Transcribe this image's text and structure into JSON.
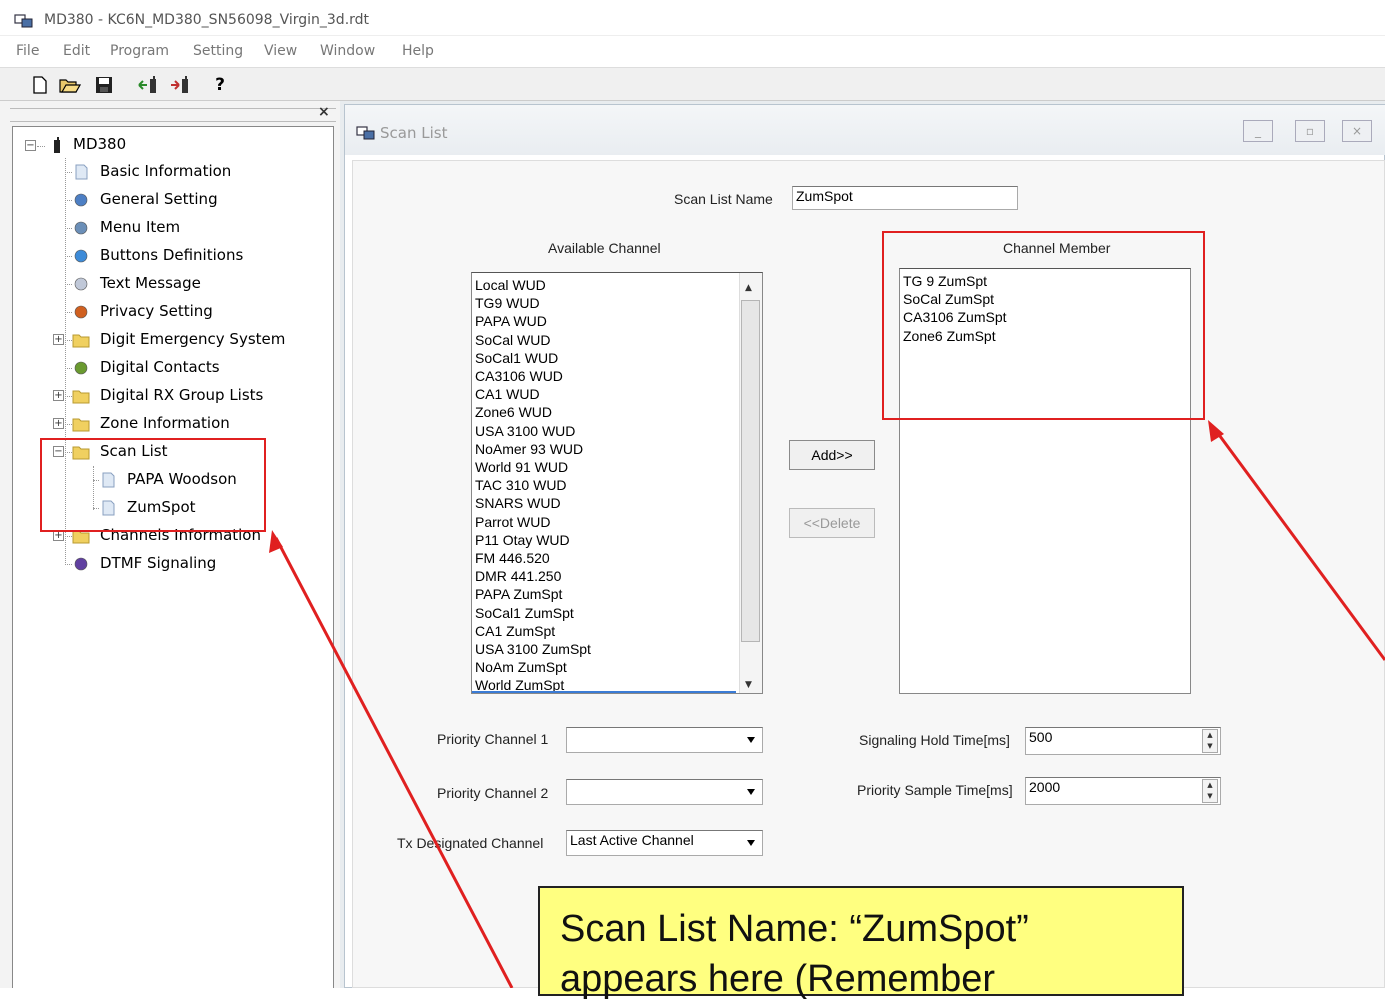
{
  "window": {
    "title": "MD380 - KC6N_MD380_SN56098_Virgin_3d.rdt"
  },
  "menu": [
    "File",
    "Edit",
    "Program",
    "Setting",
    "View",
    "Window",
    "Help"
  ],
  "toolbar": {
    "icons": [
      "new-icon",
      "open-icon",
      "save-icon",
      "read-from-radio-icon",
      "write-to-radio-icon",
      "help-icon"
    ],
    "help_glyph": "?"
  },
  "tree": {
    "close_glyph": "×",
    "root": "MD380",
    "items": [
      {
        "label": "Basic Information",
        "icon": "document-icon"
      },
      {
        "label": "General Setting",
        "icon": "gear-icon"
      },
      {
        "label": "Menu Item",
        "icon": "menu-icon"
      },
      {
        "label": "Buttons Definitions",
        "icon": "globe-icon"
      },
      {
        "label": "Text Message",
        "icon": "message-icon"
      },
      {
        "label": "Privacy Setting",
        "icon": "key-icon"
      },
      {
        "label": "Digit Emergency System",
        "icon": "folder-icon"
      },
      {
        "label": "Digital Contacts",
        "icon": "contacts-icon"
      },
      {
        "label": "Digital RX Group Lists",
        "icon": "folder-icon"
      },
      {
        "label": "Zone Information",
        "icon": "folder-icon"
      },
      {
        "label": "Scan List",
        "icon": "folder-icon"
      },
      {
        "label": "PAPA Woodson",
        "icon": "document-icon"
      },
      {
        "label": "ZumSpot",
        "icon": "document-icon"
      },
      {
        "label": "Channels Information",
        "icon": "folder-icon"
      },
      {
        "label": "DTMF Signaling",
        "icon": "dtmf-icon"
      }
    ],
    "expand_glyph": "+",
    "collapse_glyph": "−"
  },
  "scan_window": {
    "title": "Scan List",
    "minimize": "_",
    "restore": "▫",
    "close": "×",
    "scan_list_name_label": "Scan List Name",
    "scan_list_name_value": "ZumSpot",
    "available_label": "Available Channel",
    "member_label": "Channel Member",
    "available_channels": [
      "Local WUD",
      "TG9 WUD",
      "PAPA WUD",
      "SoCal WUD",
      "SoCal1 WUD",
      "CA3106 WUD",
      "CA1 WUD",
      "Zone6 WUD",
      "USA 3100 WUD",
      "NoAmer 93 WUD",
      "World 91 WUD",
      "TAC 310 WUD",
      "SNARS WUD",
      "Parrot WUD",
      "P11 Otay WUD",
      "FM 446.520",
      "DMR 441.250",
      "PAPA ZumSpt",
      "SoCal1 ZumSpt",
      "CA1 ZumSpt",
      "USA 3100 ZumSpt",
      "NoAm ZumSpt",
      "World ZumSpt"
    ],
    "channel_members": [
      "TG 9 ZumSpt",
      "SoCal ZumSpt",
      "CA3106 ZumSpt",
      "Zone6 ZumSpt"
    ],
    "add_label": "Add>>",
    "delete_label": "<<Delete",
    "priority1_label": "Priority Channel 1",
    "priority1_value": "",
    "priority2_label": "Priority Channel 2",
    "priority2_value": "",
    "tx_label": "Tx Designated Channel",
    "tx_value": "Last Active Channel",
    "hold_label": "Signaling Hold Time[ms]",
    "hold_value": "500",
    "sample_label": "Priority Sample Time[ms]",
    "sample_value": "2000"
  },
  "annotation": {
    "callout_line1": "Scan List Name:  “ZumSpot”",
    "callout_line2": "appears here (Remember",
    "highlight_color": "#e02020",
    "callout_color": "#ffff80"
  }
}
